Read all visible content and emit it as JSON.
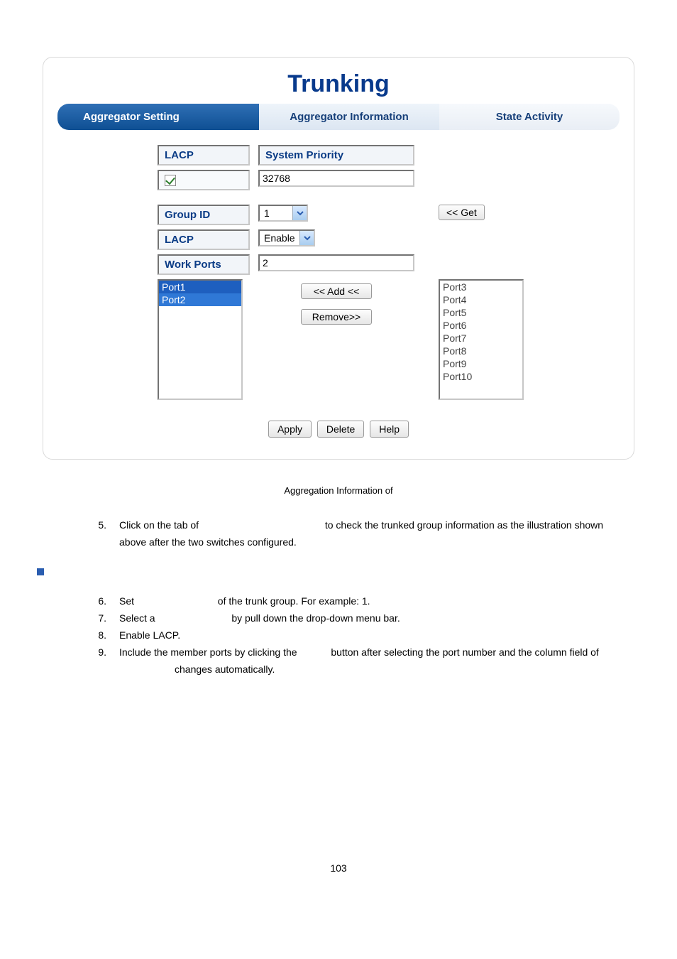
{
  "panel": {
    "title": "Trunking",
    "tabs": {
      "setting": "Aggregator Setting",
      "info": "Aggregator Information",
      "activity": "State Activity"
    },
    "row1": {
      "lacp": "LACP",
      "syspri": "System Priority",
      "syspri_val": "32768"
    },
    "row2": {
      "groupid": "Group ID",
      "groupid_val": "1",
      "get": "<< Get"
    },
    "row3": {
      "lacp": "LACP",
      "lacp_val": "Enable"
    },
    "row4": {
      "workports": "Work Ports",
      "workports_val": "2"
    },
    "leftList": [
      "Port1",
      "Port2"
    ],
    "transfer": {
      "add": "<< Add <<",
      "remove": "Remove>>"
    },
    "rightList": [
      "Port3",
      "Port4",
      "Port5",
      "Port6",
      "Port7",
      "Port8",
      "Port9",
      "Port10"
    ],
    "buttons": {
      "apply": "Apply",
      "delete": "Delete",
      "help": "Help"
    }
  },
  "caption": "Aggregation Information of",
  "doc": {
    "step5_num": "5.",
    "step5a": "Click on the tab of",
    "step5b": "to check the trunked group information as the illustration shown",
    "step5c": "above after the two switches configured.",
    "step6_num": "6.",
    "step6a": "Set",
    "step6b": "of the trunk group. For example: 1.",
    "step7_num": "7.",
    "step7a": "Select a",
    "step7b": "by pull down the drop-down menu bar.",
    "step8_num": "8.",
    "step8": "Enable LACP.",
    "step9_num": "9.",
    "step9a": "Include the member ports by clicking the",
    "step9b": "button after selecting the port number and the column field of",
    "step9c": "changes automatically."
  },
  "pagenum": "103"
}
